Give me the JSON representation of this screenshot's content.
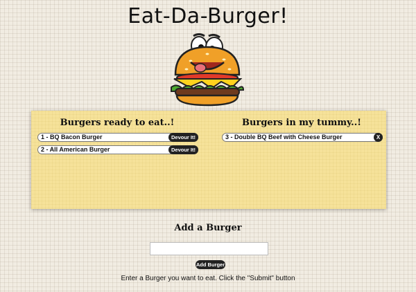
{
  "header": {
    "title": "Eat-Da-Burger!",
    "logo_icon": "cartoon-burger-icon"
  },
  "ready": {
    "heading": "Burgers ready to eat..!",
    "items": [
      {
        "label": "1 - BQ Bacon Burger",
        "button": "Devour It!"
      },
      {
        "label": "2 - All American Burger",
        "button": "Devour It!"
      }
    ]
  },
  "devoured": {
    "heading": "Burgers in my tummy..!",
    "items": [
      {
        "label": "3 - Double BQ Beef with Cheese Burger",
        "button": "X"
      }
    ]
  },
  "form": {
    "heading": "Add a Burger",
    "input_value": "",
    "input_placeholder": "",
    "submit_label": "Add Burger",
    "instructions": "Enter a Burger you want to eat. Click the \"Submit\" button"
  },
  "colors": {
    "panel": "#f6e29a",
    "button": "#222222",
    "background": "#f1ece2"
  }
}
